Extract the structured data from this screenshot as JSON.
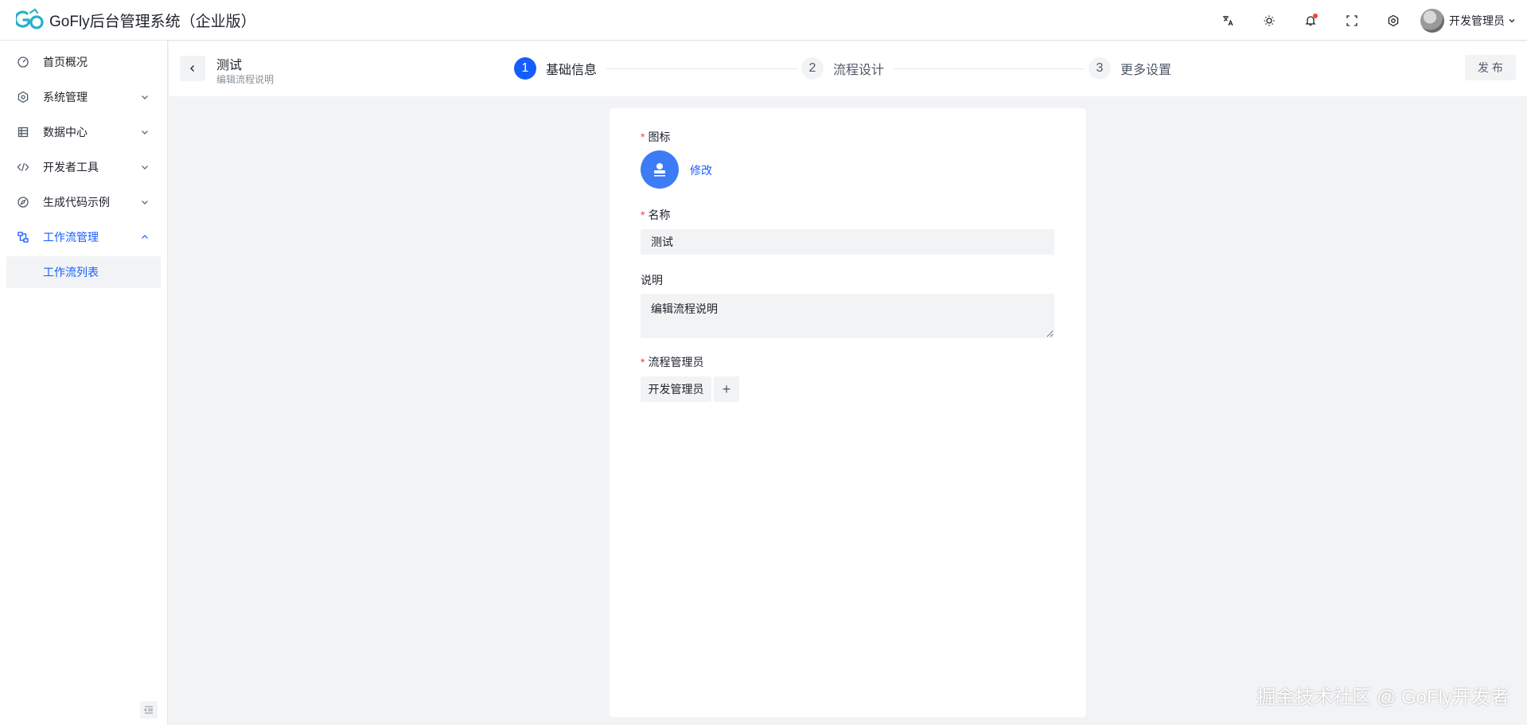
{
  "app": {
    "title": "GoFly后台管理系统（企业版）"
  },
  "header": {
    "user_name": "开发管理员"
  },
  "sidebar": {
    "items": [
      {
        "label": "首页概况"
      },
      {
        "label": "系统管理"
      },
      {
        "label": "数据中心"
      },
      {
        "label": "开发者工具"
      },
      {
        "label": "生成代码示例"
      },
      {
        "label": "工作流管理"
      }
    ],
    "sub_items": [
      {
        "label": "工作流列表"
      }
    ]
  },
  "page": {
    "title": "测试",
    "subtitle": "编辑流程说明",
    "publish_label": "发 布"
  },
  "steps": [
    {
      "num": "1",
      "label": "基础信息"
    },
    {
      "num": "2",
      "label": "流程设计"
    },
    {
      "num": "3",
      "label": "更多设置"
    }
  ],
  "form": {
    "required_mark": "*",
    "icon_label": "图标",
    "icon_edit": "修改",
    "name_label": "名称",
    "name_value": "测试",
    "desc_label": "说明",
    "desc_value": "编辑流程说明",
    "admin_label": "流程管理员",
    "admin_tag": "开发管理员",
    "add_symbol": "+"
  },
  "colors": {
    "primary": "#165dff",
    "avatar": "#3c7cf6",
    "required": "#f53f3f"
  },
  "icons": [
    "translate-icon",
    "theme-icon",
    "bell-icon",
    "fullscreen-icon",
    "settings-icon"
  ],
  "watermark": "掘金技术社区 @ GoFly开发者"
}
